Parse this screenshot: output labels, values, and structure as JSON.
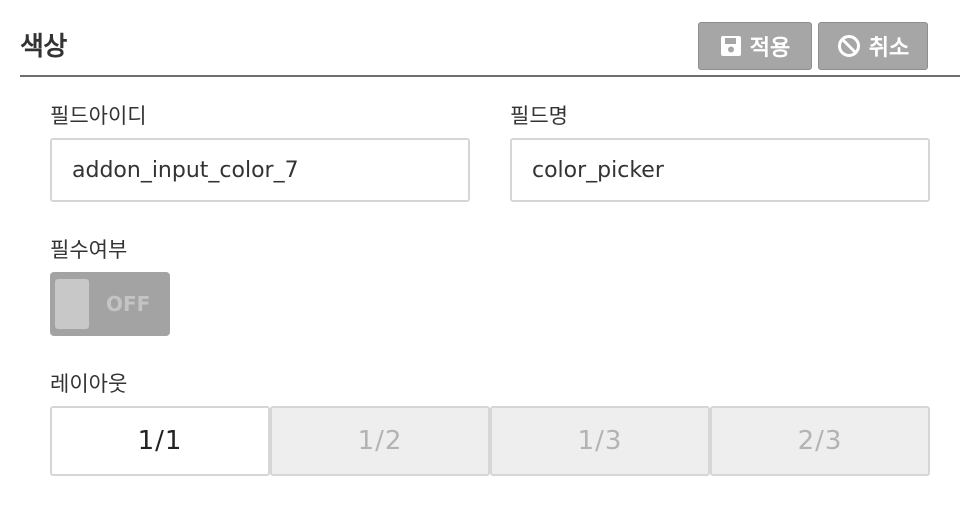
{
  "header": {
    "title": "색상",
    "apply_label": "적용",
    "cancel_label": "취소"
  },
  "form": {
    "field_id": {
      "label": "필드아이디",
      "value": "addon_input_color_7"
    },
    "field_name": {
      "label": "필드명",
      "value": "color_picker"
    },
    "required": {
      "label": "필수여부",
      "state": "OFF"
    },
    "layout": {
      "label": "레이아웃",
      "options": [
        "1/1",
        "1/2",
        "1/3",
        "2/3"
      ],
      "selected": "1/1"
    }
  },
  "colors": {
    "button_bg": "#a6a6a6",
    "toggle_bg": "#a3a3a3",
    "segment_inactive_bg": "#eeeeee"
  },
  "icons": {
    "apply": "save-icon",
    "cancel": "ban-icon"
  }
}
